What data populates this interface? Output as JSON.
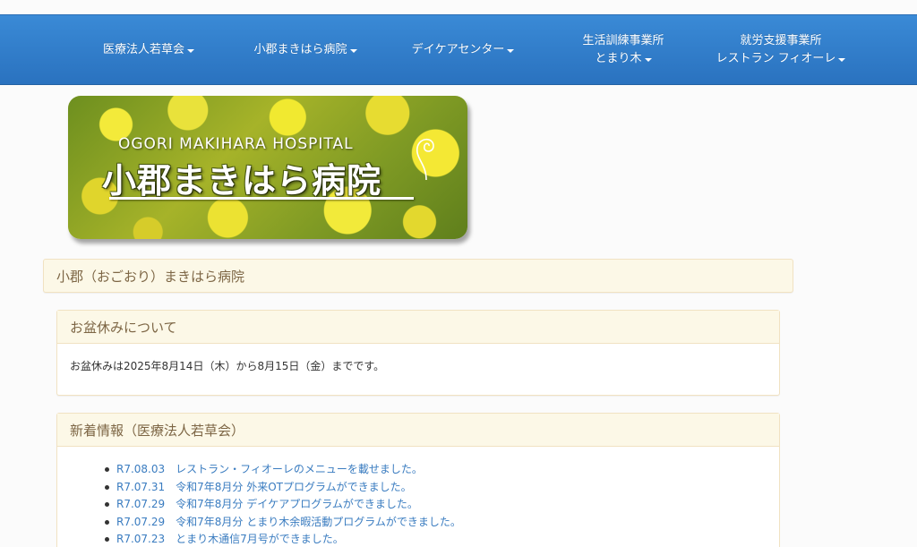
{
  "navbar": {
    "items": [
      {
        "lines": [
          "医療法人若草会"
        ]
      },
      {
        "lines": [
          "小郡まきはら病院"
        ]
      },
      {
        "lines": [
          "デイケアセンター"
        ]
      },
      {
        "lines": [
          "生活訓練事業所",
          "とまり木"
        ]
      },
      {
        "lines": [
          "就労支援事業所",
          "レストラン フィオーレ"
        ]
      }
    ]
  },
  "banner": {
    "english": "OGORI MAKIHARA HOSPITAL",
    "japanese": "小郡まきはら病院"
  },
  "main": {
    "title": "小郡（おごおり）まきはら病院"
  },
  "notice": {
    "title": "お盆休みについて",
    "body": "お盆休みは2025年8月14日（木）から8月15日（金）までです。"
  },
  "news": {
    "title": "新着情報（医療法人若草会）",
    "items": [
      {
        "date": "R7.08.03",
        "text": "レストラン・フィオーレのメニューを載せました。"
      },
      {
        "date": "R7.07.31",
        "text": "令和7年8月分 外来OTプログラムができました。"
      },
      {
        "date": "R7.07.29",
        "text": "令和7年8月分 デイケアプログラムができました。"
      },
      {
        "date": "R7.07.29",
        "text": "令和7年8月分 とまり木余暇活動プログラムができました。"
      },
      {
        "date": "R7.07.23",
        "text": "とまり木通信7月号ができました。"
      }
    ]
  },
  "colors": {
    "navbar": "#2f7cc9",
    "panel_heading_bg": "#fcf8e7",
    "panel_heading_text": "#7d6645",
    "link": "#3a7cc0"
  }
}
